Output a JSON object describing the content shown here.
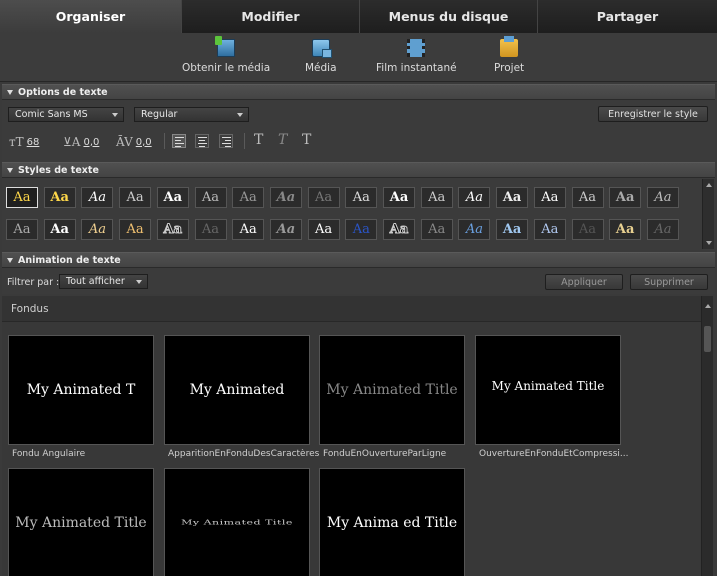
{
  "tabs": [
    {
      "label": "Organiser",
      "active": true
    },
    {
      "label": "Modifier",
      "active": false
    },
    {
      "label": "Menus du disque",
      "active": false
    },
    {
      "label": "Partager",
      "active": false
    }
  ],
  "toolbar": {
    "get_media": "Obtenir le média",
    "media": "Média",
    "instant_movie": "Film instantané",
    "project": "Projet"
  },
  "text_options": {
    "header": "Options de texte",
    "font": "Comic Sans MS",
    "font_style": "Regular",
    "save_style": "Enregistrer le style",
    "size": "68",
    "leading": "0,0",
    "kerning": "0,0"
  },
  "text_styles": {
    "header": "Styles de texte",
    "swatch_glyph": "Aa",
    "row1": [
      "#ffd84a",
      "#ffd84a",
      "#ffffff",
      "#cccccc",
      "#ffffff",
      "#bbbbbb",
      "#999999",
      "#888888",
      "#777777",
      "#dddddd",
      "#ffffff",
      "#cccccc",
      "#ffffff",
      "#eeeeee",
      "#ffffff",
      "#cccccc",
      "#aaaaaa",
      "#bbbbbb"
    ],
    "row2": [
      "#aaaaaa",
      "#ffffff",
      "#f0d090",
      "#f0c070",
      "#111111",
      "#666666",
      "#ffffff",
      "#999999",
      "#ffffff",
      "#2b55c8",
      "#000000",
      "#888888",
      "#6aa0e0",
      "#a0c8f0",
      "#b0c8f0",
      "#555555",
      "#e8d090",
      "#666666"
    ]
  },
  "animation": {
    "header": "Animation de texte",
    "filter_label": "Filtrer par :",
    "filter_value": "Tout afficher",
    "apply": "Appliquer",
    "delete": "Supprimer",
    "category": "Fondus",
    "items": [
      {
        "preview": "My Animated T",
        "name": "Fondu Angulaire"
      },
      {
        "preview": "My Animated",
        "name": "ApparitionEnFonduDesCaractères"
      },
      {
        "preview": "My Animated Title",
        "name": "FonduEnOuvertureParLigne"
      },
      {
        "preview": "My Animated Title",
        "name": "OuvertureEnFonduEtCompressi..."
      },
      {
        "preview": "My Animated Title",
        "name": ""
      },
      {
        "preview": "My Animated Title",
        "name": ""
      },
      {
        "preview": "My Anima ed Title",
        "name": ""
      }
    ]
  }
}
